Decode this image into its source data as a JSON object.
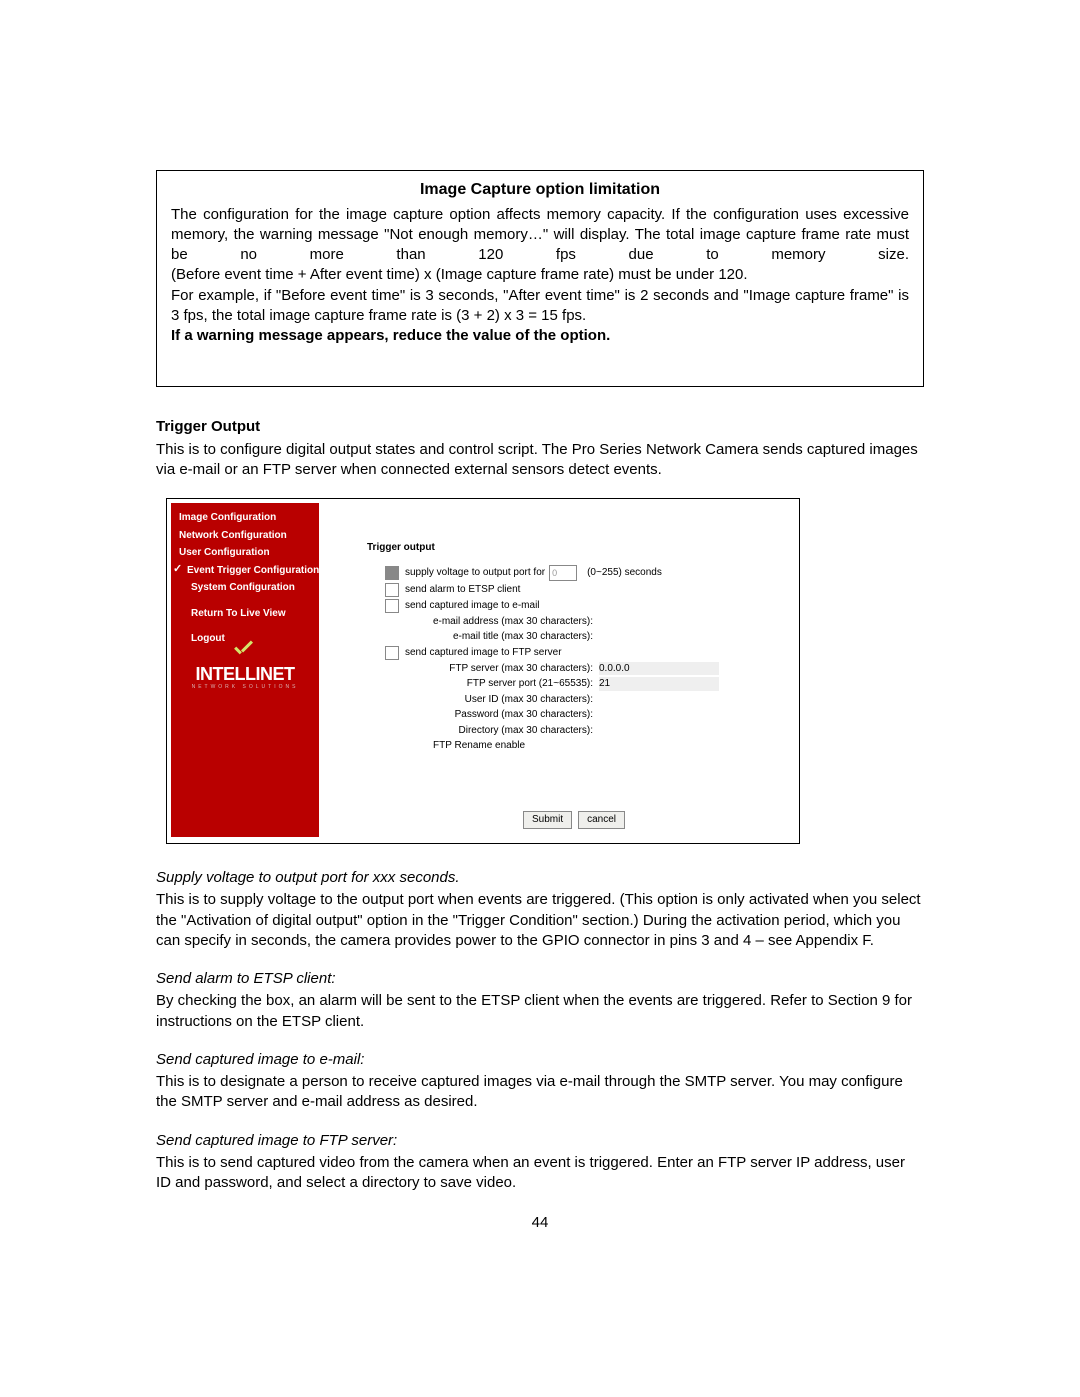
{
  "cap_box": {
    "title": "Image Capture option limitation",
    "line1": "The configuration for the image capture option affects memory capacity. If the configuration uses excessive memory, the warning message \"Not enough memory…\" will display. The total image capture frame rate must be no more than 120 fps due to memory size.",
    "line2": "(Before event time + After event time) x (Image capture frame rate) must be under 120.",
    "line3": "For example, if \"Before event time\" is 3 seconds, \"After event time\" is 2 seconds and \"Image capture frame\" is 3 fps, the total image capture frame rate is (3 + 2) x 3 = 15 fps.",
    "line4": "If a warning message appears, reduce the value of the option."
  },
  "section": {
    "title": "Trigger Output",
    "body": "This is to configure digital output states and control script. The Pro Series Network Camera sends captured images via e-mail or an FTP server when connected external sensors detect events."
  },
  "app": {
    "sidebar": {
      "items": [
        "Image Configuration",
        "Network Configuration",
        "User Configuration",
        "Event Trigger Configuration",
        "System Configuration",
        "Return To Live View",
        "Logout"
      ],
      "logo": {
        "text": "INTELLINET",
        "sub": "NETWORK  SOLUTIONS"
      }
    },
    "panel": {
      "title": "Trigger output",
      "supply_label": "supply voltage to output port for",
      "supply_value": "0",
      "supply_suffix": "(0~255) seconds",
      "etsp_label": "send alarm to ETSP client",
      "email_label": "send captured image to e-mail",
      "email_addr_label": "e-mail address (max 30 characters):",
      "email_title_label": "e-mail title (max 30 characters):",
      "ftp_label": "send captured image to FTP server",
      "ftp_server_label": "FTP server (max 30 characters):",
      "ftp_server_value": "0.0.0.0",
      "ftp_port_label": "FTP server port (21~65535):",
      "ftp_port_value": "21",
      "ftp_user_label": "User ID (max 30 characters):",
      "ftp_pass_label": "Password (max 30 characters):",
      "ftp_dir_label": "Directory (max 30 characters):",
      "ftp_rename_label": "FTP Rename enable",
      "submit": "Submit",
      "cancel": "cancel"
    }
  },
  "desc": {
    "h1": "Supply voltage to output port for xxx seconds.",
    "b1": "This is to supply voltage to the output port when events are triggered. (This option is only activated when you select the \"Activation of digital output\" option in the \"Trigger Condition\" section.) During the activation period, which you can specify in seconds, the camera provides power to the GPIO connector in pins 3 and 4 – see Appendix F.",
    "h2": "Send alarm to ETSP client:",
    "b2": "By checking the box, an alarm will be sent to the ETSP client when the events are triggered. Refer to Section 9 for instructions on the ETSP client.",
    "h3": "Send captured image to e-mail:",
    "b3": "This is to designate a person to receive captured images via e-mail through the SMTP server. You may configure the SMTP server and e-mail address as desired.",
    "h4": "Send captured image to FTP server:",
    "b4": "This is to send captured video from the camera when an event is triggered. Enter an FTP server IP address, user ID and password, and select a directory to save video."
  },
  "page_number": "44"
}
